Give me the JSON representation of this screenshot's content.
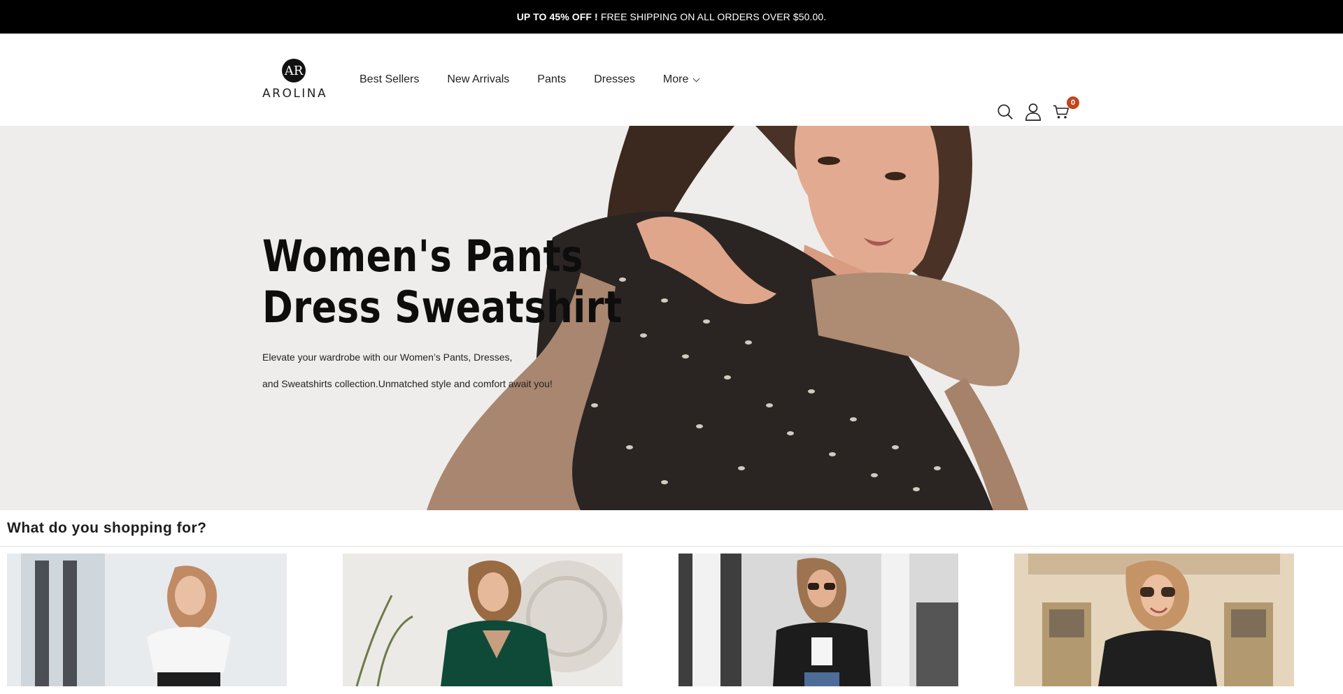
{
  "announcement": {
    "bold": "UP TO 45% OFF !",
    "text": "FREE SHIPPING ON ALL ORDERS OVER $50.00."
  },
  "brand": {
    "mark": "AR",
    "name": "AROLINA"
  },
  "nav": {
    "items": [
      "Best Sellers",
      "New Arrivals",
      "Pants",
      "Dresses"
    ],
    "more": "More"
  },
  "header_icons": [
    "search-icon",
    "account-icon",
    "cart-icon"
  ],
  "cart": {
    "count": "0",
    "badge_color": "#c3441c"
  },
  "hero": {
    "title_line1": "Women's Pants",
    "title_line2": "Dress Sweatshirt",
    "sub_line1": "Elevate your wardrobe with our Women’s Pants, Dresses,",
    "sub_line2": "and Sweatshirts collection.Unmatched style and comfort await you!"
  },
  "categories_section": {
    "title": "What do you shopping for?"
  }
}
